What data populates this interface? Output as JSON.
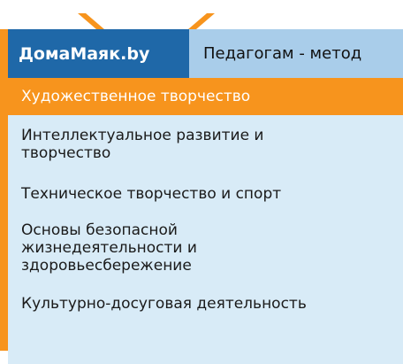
{
  "colors": {
    "accent_orange": "#f7941d",
    "brand_blue": "#1f68a8",
    "topbar_light_blue": "#a9cdea",
    "menu_background": "#d8ebf7"
  },
  "header": {
    "brand": "ДомаМаяк.by",
    "teachers_link": "Педагогам - метод"
  },
  "menu": {
    "items": [
      {
        "label": "Художественное творчество",
        "active": true
      },
      {
        "label": "Интеллектуальное развитие и творчество",
        "active": false
      },
      {
        "label": "Техническое творчество и спорт",
        "active": false
      },
      {
        "label": "Основы безопасной жизнедеятельности и здоровьесбережение",
        "active": false
      },
      {
        "label": "Культурно-досуговая деятельность",
        "active": false
      }
    ]
  }
}
